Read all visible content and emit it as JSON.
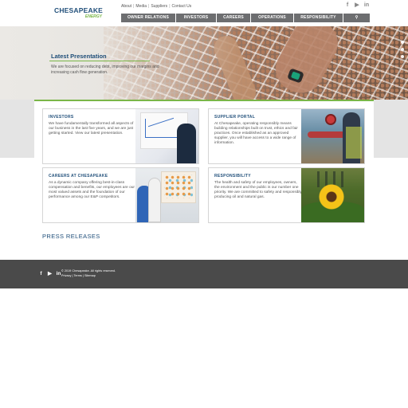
{
  "header": {
    "logo_main": "CHESAPEAKE",
    "logo_sub": "ENERGY",
    "util_links": [
      "About",
      "Media",
      "Suppliers",
      "Contact Us"
    ],
    "social_icons": [
      "facebook-icon",
      "youtube-icon",
      "linkedin-icon"
    ],
    "social_glyphs": [
      "f",
      "▶",
      "in"
    ],
    "nav": [
      {
        "label": "OWNER RELATIONS"
      },
      {
        "label": "INVESTORS"
      },
      {
        "label": "CAREERS"
      },
      {
        "label": "OPERATIONS"
      },
      {
        "label": "RESPONSIBILITY"
      }
    ],
    "search_glyph": "⚲"
  },
  "hero": {
    "title": "Latest Presentation",
    "text": "We are focused on reducing debt, improving our margins and increasing cash flow generation.",
    "slide_count": 3
  },
  "cards": [
    {
      "title": "INVESTORS",
      "body": "We have fundamentally transformed all aspects of our business in the last five years, and we are just getting started. View our latest presentation."
    },
    {
      "title": "SUPPLIER PORTAL",
      "body": "At Chesapeake, operating responsibly means building relationships built on trust, ethics and fair practices. Once established as an approved supplier, you will have access to a wide range of information."
    },
    {
      "title": "CAREERS AT CHESAPEAKE",
      "body": "As a dynamic company offering best-in-class compensation and benefits, our employees are our most valued assets and the foundation of our performance among our E&P competitors."
    },
    {
      "title": "RESPONSIBILITY",
      "body": "The health and safety of our employees, owners, the environment and the public is our number one priority. We are committed to safety and responsibly producing oil and natural gas."
    }
  ],
  "press": {
    "title": "PRESS RELEASES"
  },
  "footer": {
    "copyright": "© 2019 Chesapeake. All rights reserved.",
    "links": [
      "Privacy",
      "Terms",
      "Sitemap"
    ],
    "social_glyphs": [
      "f",
      "▶",
      "in"
    ]
  },
  "colors": {
    "brand_blue": "#1f4e79",
    "brand_green": "#7ab648",
    "nav_gray": "#6d6e70",
    "footer_gray": "#4a4a4a"
  }
}
